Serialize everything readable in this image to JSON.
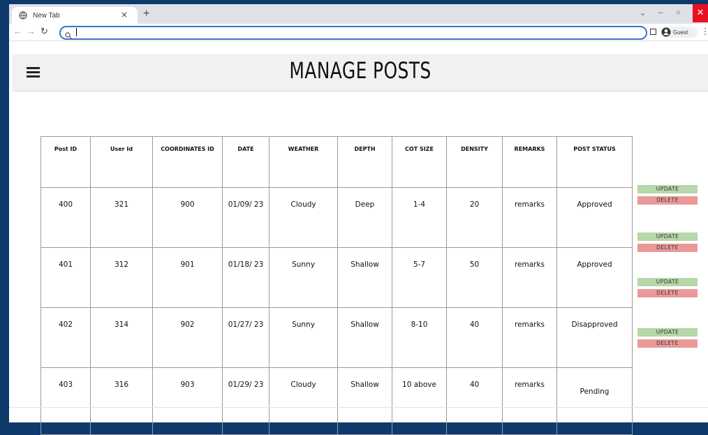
{
  "browser": {
    "tab_title": "New Tab",
    "tab_close": "×",
    "new_tab": "+",
    "profile_label": "Guest",
    "colors": {
      "tabbar": "#dee1e6",
      "omnibox_border": "#3b73c8",
      "close_red": "#e81123"
    }
  },
  "header": {
    "title": "MANAGE POSTS"
  },
  "table": {
    "columns": [
      "Post ID",
      "User Id",
      "COORDINATES ID",
      "DATE",
      "WEATHER",
      "DEPTH",
      "COT SIZE",
      "DENSITY",
      "REMARKS",
      "POST STATUS"
    ],
    "rows": [
      [
        "400",
        "321",
        "900",
        "01/09/ 23",
        "Cloudy",
        "Deep",
        "1-4",
        "20",
        "remarks",
        "Approved"
      ],
      [
        "401",
        "312",
        "901",
        "01/18/ 23",
        "Sunny",
        "Shallow",
        "5-7",
        "50",
        "remarks",
        "Approved"
      ],
      [
        "402",
        "314",
        "902",
        "01/27/ 23",
        "Sunny",
        "Shallow",
        "8-10",
        "40",
        "remarks",
        "Disapproved"
      ],
      [
        "403",
        "316",
        "903",
        "01/29/ 23",
        "Cloudy",
        "Shallow",
        "10 above",
        "40",
        "remarks",
        "Pending"
      ]
    ]
  },
  "actions": {
    "update_label": "UPDATE",
    "delete_label": "DELETE",
    "update_color": "#b6d7a8",
    "delete_color": "#ea9999"
  }
}
